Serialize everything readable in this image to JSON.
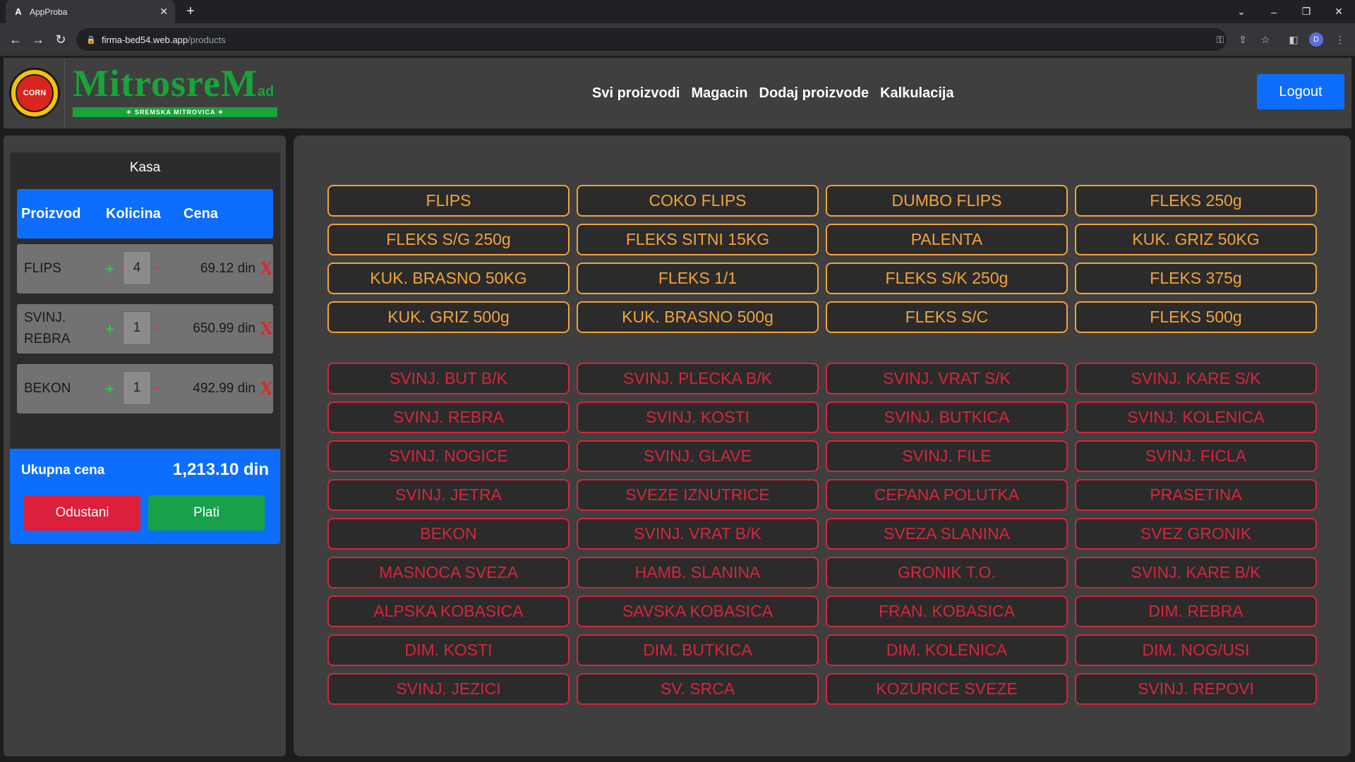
{
  "browser": {
    "tab_title": "AppProba",
    "tab_favicon": "A",
    "url_host": "firma-bed54.web.app",
    "url_path": "/products",
    "profile_initial": "D"
  },
  "header": {
    "logo_text": "CORN",
    "brand_name": "MitrosreM",
    "brand_suffix": "ad",
    "brand_tagline": "✶ SREMSKA MITROVICA ✶",
    "nav": [
      "Svi proizvodi",
      "Magacin",
      "Dodaj proizvode",
      "Kalkulacija"
    ],
    "logout_label": "Logout"
  },
  "kasa": {
    "title": "Kasa",
    "columns": [
      "Proizvod",
      "Kolicina",
      "Cena"
    ],
    "items": [
      {
        "name": "FLIPS",
        "qty": "4",
        "price": "69.12 din"
      },
      {
        "name": "SVINJ. REBRA",
        "qty": "1",
        "price": "650.99 din"
      },
      {
        "name": "BEKON",
        "qty": "1",
        "price": "492.99 din"
      }
    ],
    "plus": "+",
    "minus": "-",
    "delete": "X",
    "total_label": "Ukupna cena",
    "total_value": "1,213.10 din",
    "cancel_label": "Odustani",
    "pay_label": "Plati"
  },
  "products": {
    "corn": [
      "FLIPS",
      "COKO FLIPS",
      "DUMBO FLIPS",
      "FLEKS 250g",
      "FLEKS S/G 250g",
      "FLEKS SITNI 15KG",
      "PALENTA",
      "KUK. GRIZ 50KG",
      "KUK. BRASNO 50KG",
      "FLEKS 1/1",
      "FLEKS S/K 250g",
      "FLEKS 375g",
      "KUK. GRIZ 500g",
      "KUK. BRASNO 500g",
      "FLEKS S/C",
      "FLEKS 500g"
    ],
    "meat": [
      "SVINJ. BUT B/K",
      "SVINJ. PLECKA B/K",
      "SVINJ. VRAT S/K",
      "SVINJ. KARE S/K",
      "SVINJ. REBRA",
      "SVINJ. KOSTI",
      "SVINJ. BUTKICA",
      "SVINJ. KOLENICA",
      "SVINJ. NOGICE",
      "SVINJ. GLAVE",
      "SVINJ. FILE",
      "SVINJ. FICLA",
      "SVINJ. JETRA",
      "SVEZE IZNUTRICE",
      "CEPANA POLUTKA",
      "PRASETINA",
      "BEKON",
      "SVINJ. VRAT B/K",
      "SVEZA SLANINA",
      "SVEZ GRONIK",
      "MASNOCA SVEZA",
      "HAMB. SLANINA",
      "GRONIK T.O.",
      "SVINJ. KARE B/K",
      "ALPSKA KOBASICA",
      "SAVSKA KOBASICA",
      "FRAN. KOBASICA",
      "DIM. REBRA",
      "DIM. KOSTI",
      "DIM. BUTKICA",
      "DIM. KOLENICA",
      "DIM. NOG/USI",
      "SVINJ. JEZICI",
      "SV. SRCA",
      "KOZURICE SVEZE",
      "SVINJ. REPOVI"
    ]
  },
  "colors": {
    "accent": "#0d6efd",
    "corn_products": "#f2a33a",
    "meat_products": "#d6263c",
    "cancel": "#dc1f3b",
    "pay": "#18a04a"
  }
}
